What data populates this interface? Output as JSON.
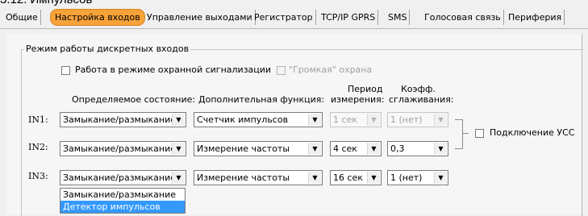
{
  "page_heading": "3.12. Импульсов",
  "tabs": [
    {
      "label": "Общие",
      "active": false
    },
    {
      "label": "Настройка входов",
      "active": true
    },
    {
      "label": "Управление выходами",
      "active": false
    },
    {
      "label": "Регистратор",
      "active": false
    },
    {
      "label": "TCP/IP GPRS",
      "active": false
    },
    {
      "label": "SMS",
      "active": false
    },
    {
      "label": "Голосовая связь",
      "active": false
    },
    {
      "label": "Периферия",
      "active": false
    }
  ],
  "group": {
    "title": "Режим работы дискретных входов",
    "security_mode": {
      "label": "Работа в режиме охранной сигнализации",
      "checked": false
    },
    "loud_guard": {
      "label": "\"Громкая\" охрана",
      "checked": false,
      "enabled": false
    }
  },
  "columns": {
    "state": "Определяемое состояние:",
    "function": "Дополнительная функция:",
    "period_1": "Период",
    "period_2": "измерения:",
    "smooth_1": "Коэфф.",
    "smooth_2": "сглаживания:"
  },
  "rows": [
    {
      "label": "IN1:",
      "state": "Замыкание/размыкание",
      "function": "Счетчик импульсов",
      "period": "1 сек",
      "smooth": "1 (нет)",
      "period_enabled": false
    },
    {
      "label": "IN2:",
      "state": "Замыкание/размыкание",
      "function": "Измерение частоты",
      "period": "4 сек",
      "smooth": "0,3",
      "period_enabled": true
    },
    {
      "label": "IN3:",
      "state": "Замыкание/размыкание",
      "function": "Измерение частоты",
      "period": "16 сек",
      "smooth": "1 (нет)",
      "period_enabled": true
    }
  ],
  "usc": {
    "label": "Подключение УСС",
    "checked": false
  },
  "dropdown_options": [
    {
      "label": "Замыкание/размыкание",
      "highlighted": false
    },
    {
      "label": "Детектор импульсов",
      "highlighted": true
    }
  ],
  "colors": {
    "active_tab": "#f8a23a",
    "highlight": "#3399ff"
  }
}
